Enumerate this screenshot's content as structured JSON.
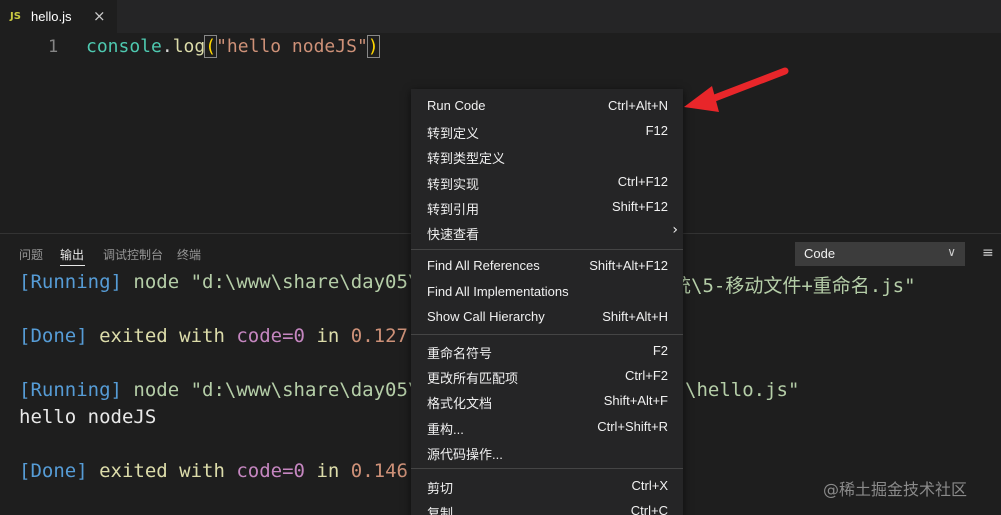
{
  "tab": {
    "icon": "JS",
    "title": "hello.js",
    "close": "×"
  },
  "editor": {
    "line_number": "1",
    "code": {
      "obj": "console",
      "dot": ".",
      "fn": "log",
      "open": "(",
      "str": "\"hello nodeJS\"",
      "close": ")"
    }
  },
  "panel": {
    "tabs": [
      "问题",
      "输出",
      "调试控制台",
      "终端"
    ],
    "dropdown_value": "Code",
    "dropdown_chevron": "∨",
    "list_icon": "≡",
    "output": {
      "l1": {
        "tag": "[Running]",
        "rest": " node \"d:\\www\\share\\day05\\",
        "tail": "统\\5-移动文件+重命名.js\""
      },
      "l2": {
        "tag": "[Done]",
        "rest": " exited with ",
        "code": "code=0",
        "in": " in ",
        "time": "0.127"
      },
      "l3": {
        "tag": "[Running]",
        "rest": " node \"d:\\www\\share\\day05\\",
        "tail": "\\hello.js\""
      },
      "l4": {
        "text": "hello nodeJS"
      },
      "l5": {
        "tag": "[Done]",
        "rest": " exited with ",
        "code": "code=0",
        "in": " in ",
        "time": "0.146"
      }
    }
  },
  "menu": {
    "items": [
      {
        "label": "Run Code",
        "key": "Ctrl+Alt+N"
      },
      {
        "label": "转到定义",
        "key": "F12"
      },
      {
        "label": "转到类型定义",
        "key": ""
      },
      {
        "label": "转到实现",
        "key": "Ctrl+F12"
      },
      {
        "label": "转到引用",
        "key": "Shift+F12"
      },
      {
        "label": "快速查看",
        "key": ""
      },
      {
        "label": "Find All References",
        "key": "Shift+Alt+F12"
      },
      {
        "label": "Find All Implementations",
        "key": ""
      },
      {
        "label": "Show Call Hierarchy",
        "key": "Shift+Alt+H"
      },
      {
        "label": "重命名符号",
        "key": "F2"
      },
      {
        "label": "更改所有匹配项",
        "key": "Ctrl+F2"
      },
      {
        "label": "格式化文档",
        "key": "Shift+Alt+F"
      },
      {
        "label": "重构...",
        "key": "Ctrl+Shift+R"
      },
      {
        "label": "源代码操作...",
        "key": ""
      },
      {
        "label": "剪切",
        "key": "Ctrl+X"
      },
      {
        "label": "复制",
        "key": "Ctrl+C"
      }
    ],
    "submenu_arrow": "›"
  },
  "watermark": "@稀土掘金技术社区",
  "colors": {
    "annotation_arrow": "#e8262a",
    "accent_js": "#cbcb41"
  }
}
